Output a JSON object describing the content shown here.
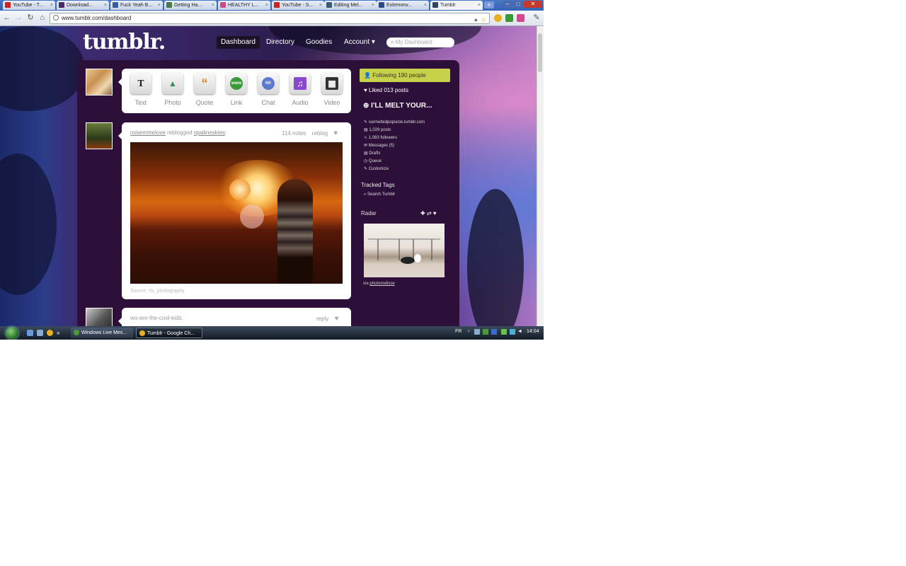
{
  "browser": {
    "tabs": [
      {
        "label": "YouTube - T...",
        "favicon_color": "#cc2222"
      },
      {
        "label": "Download...",
        "favicon_color": "#4a2a6a"
      },
      {
        "label": "Fuck Yeah B...",
        "favicon_color": "#3a5aa0"
      },
      {
        "label": "Getting Ha...",
        "favicon_color": "#4a7a4a"
      },
      {
        "label": "HEALTHY L...",
        "favicon_color": "#c84a8a"
      },
      {
        "label": "YouTube - S...",
        "favicon_color": "#cc2222"
      },
      {
        "label": "Editing Mel...",
        "favicon_color": "#3a5a7a"
      },
      {
        "label": "Exlemonv...",
        "favicon_color": "#2a4a8a"
      },
      {
        "label": "Tumblr",
        "favicon_color": "#2c4762"
      }
    ],
    "url": "www.tumblr.com/dashboard",
    "new_tab_label": "+",
    "window_buttons": {
      "min": "–",
      "max": "□",
      "close": "✕"
    }
  },
  "tumblr": {
    "logo": "tumblr.",
    "nav": {
      "dashboard": "Dashboard",
      "directory": "Directory",
      "goodies": "Goodies",
      "account": "Account ▾"
    },
    "search_placeholder": "My Dashboard",
    "post_types": [
      {
        "label": "Text",
        "icon": "text-icon",
        "glyph": "T",
        "color": "#222222"
      },
      {
        "label": "Photo",
        "icon": "photo-icon",
        "glyph": "▲",
        "color": "#3a8a5a"
      },
      {
        "label": "Quote",
        "icon": "quote-icon",
        "glyph": "“",
        "color": "#e07a1a"
      },
      {
        "label": "Link",
        "icon": "link-icon",
        "glyph": "www",
        "color": "#3a9a3a"
      },
      {
        "label": "Chat",
        "icon": "chat-icon",
        "glyph": "Hi!",
        "color": "#5a7ad0"
      },
      {
        "label": "Audio",
        "icon": "audio-icon",
        "glyph": "♫",
        "color": "#8a4ad0"
      },
      {
        "label": "Video",
        "icon": "video-icon",
        "glyph": "▦",
        "color": "#333333"
      }
    ],
    "post1": {
      "reblogger": "roisemmelove",
      "reblogged_word": "reblogged",
      "original": "opalineskies",
      "notes": "114 notes",
      "reblog": "reblog",
      "source_text": "Source: rts_photography"
    },
    "post2": {
      "author": "wo-are-the-cool-kids",
      "reply": "reply"
    },
    "sidebar": {
      "following": "Following 190 people",
      "liked": "Liked 013 posts",
      "blog_title": "I'LL MELT YOUR...",
      "blog_items": [
        "surmeltedpopsicle.tumblr.com",
        "1,029 posts",
        "1,083 followers",
        "Messages (5)",
        "Drafts",
        "Queue",
        "Customize"
      ],
      "tracked_tags": "Tracked Tags",
      "search_tumblr": "Search Tumblr",
      "radar": "Radar",
      "via_prefix": "via",
      "via_user": "photomelisse"
    }
  },
  "taskbar": {
    "buttons": [
      {
        "label": "Windows Live Mes..."
      },
      {
        "label": "Tumblr - Google Ch..."
      }
    ],
    "lang": "FR",
    "clock": "14:04"
  }
}
